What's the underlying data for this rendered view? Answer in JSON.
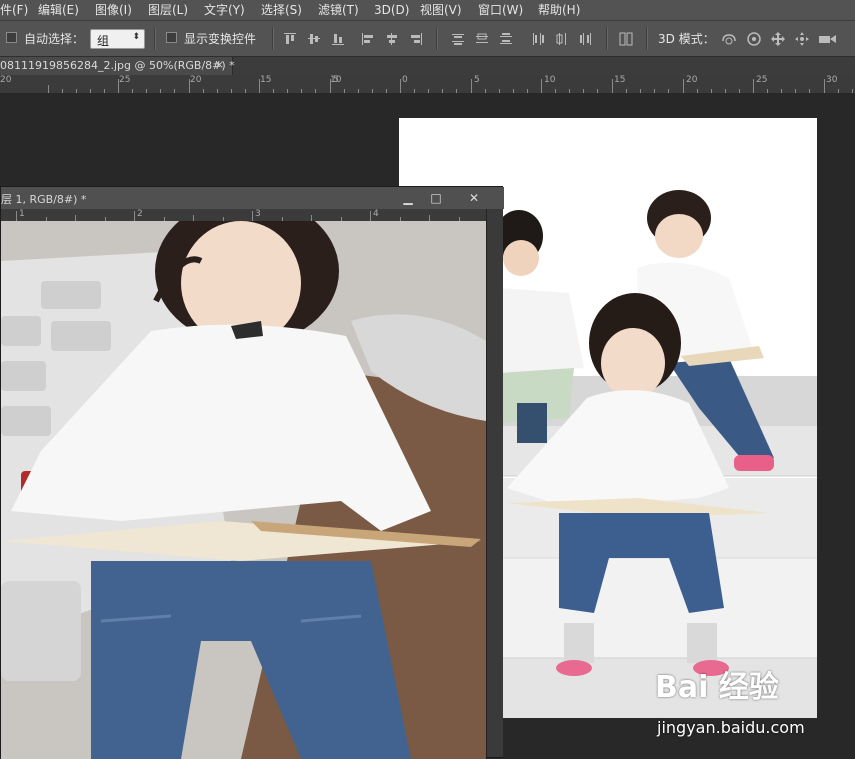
{
  "menubar": {
    "items": [
      {
        "label": "件(F)"
      },
      {
        "label": "编辑(E)"
      },
      {
        "label": "图像(I)"
      },
      {
        "label": "图层(L)"
      },
      {
        "label": "文字(Y)"
      },
      {
        "label": "选择(S)"
      },
      {
        "label": "滤镜(T)"
      },
      {
        "label": "3D(D)"
      },
      {
        "label": "视图(V)"
      },
      {
        "label": "窗口(W)"
      },
      {
        "label": "帮助(H)"
      }
    ]
  },
  "options": {
    "auto_select_label": "自动选择：",
    "auto_select_checked": false,
    "group_select_value": "组",
    "show_transform_label": "显示变换控件",
    "show_transform_checked": false,
    "mode_3d_label": "3D 模式："
  },
  "document_tab": {
    "title": "08111919856284_2.jpg @ 50%(RGB/8#) *",
    "close": "×"
  },
  "top_ruler": {
    "labels": [
      "20",
      "25",
      "20",
      "15",
      "10",
      "5",
      "0",
      "5",
      "10",
      "15",
      "20",
      "25",
      "30"
    ]
  },
  "float_window": {
    "title": "层 1, RGB/8#) *",
    "minimize": "▁",
    "maximize": "□",
    "close": "✕",
    "ruler_labels": [
      "1",
      "2",
      "3",
      "4"
    ]
  },
  "watermark": {
    "brand": "Bai 经验",
    "url": "jingyan.baidu.com"
  },
  "colors": {
    "menubar": "#535353",
    "workspace": "#282828",
    "panel": "#535353"
  }
}
